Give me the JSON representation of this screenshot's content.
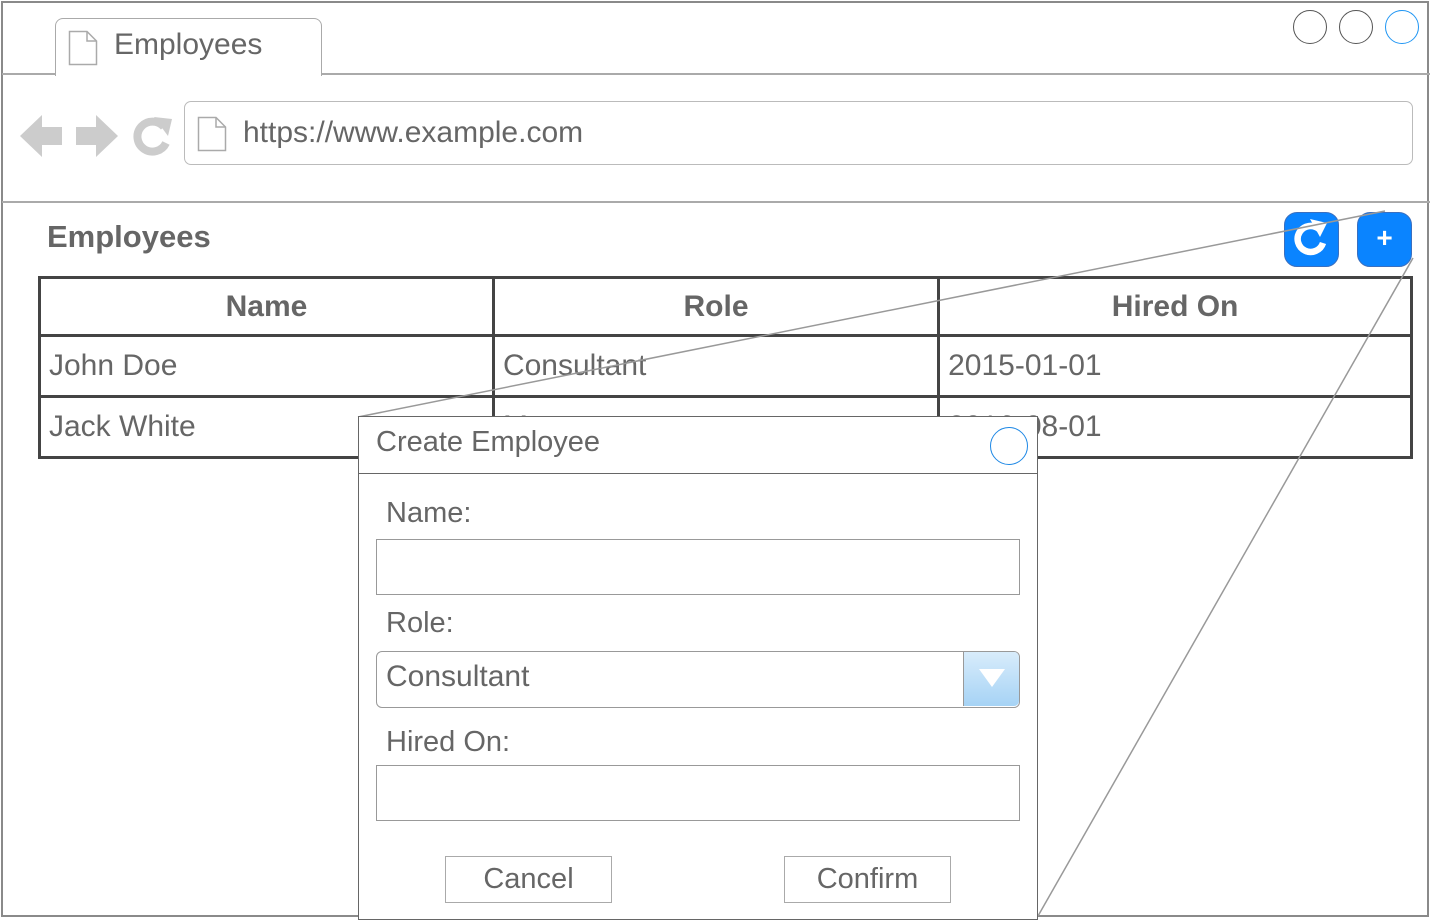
{
  "browser": {
    "tab_title": "Employees",
    "url": "https://www.example.com"
  },
  "page": {
    "title": "Employees",
    "refresh_icon": "refresh-icon",
    "add_label": "+"
  },
  "table": {
    "headers": [
      "Name",
      "Role",
      "Hired On"
    ],
    "rows": [
      [
        "John Doe",
        "Consultant",
        "2015-01-01"
      ],
      [
        "Jack White",
        "Manager",
        "2016-08-01"
      ]
    ]
  },
  "dialog": {
    "title": "Create Employee",
    "name_label": "Name:",
    "name_value": "",
    "role_label": "Role:",
    "role_value": "Consultant",
    "hired_label": "Hired On:",
    "hired_value": "",
    "cancel_label": "Cancel",
    "confirm_label": "Confirm"
  },
  "colors": {
    "accent": "#0a84ff",
    "border": "#444444",
    "text": "#666666",
    "dropdown_arrow": "#a6d3f5"
  }
}
